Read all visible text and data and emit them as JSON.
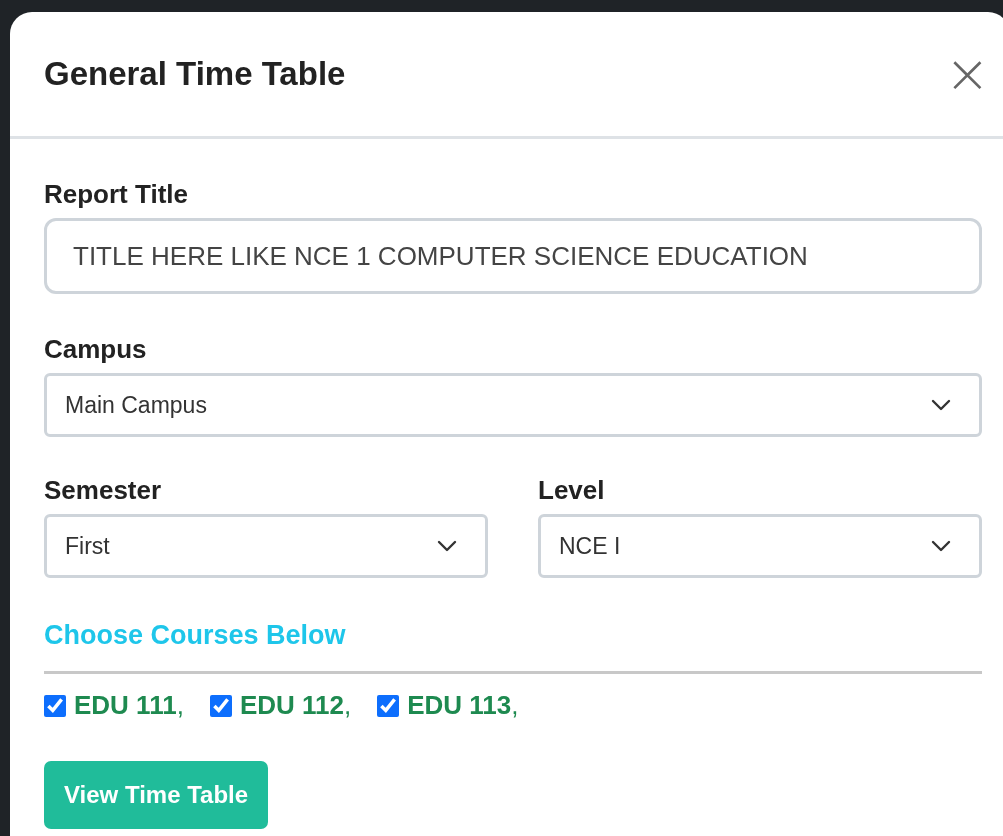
{
  "modal": {
    "title": "General Time Table",
    "close": "×"
  },
  "form": {
    "report_title": {
      "label": "Report Title",
      "placeholder": "TITLE HERE LIKE NCE 1 COMPUTER SCIENCE EDUCATION"
    },
    "campus": {
      "label": "Campus",
      "value": "Main Campus"
    },
    "semester": {
      "label": "Semester",
      "value": "First"
    },
    "level": {
      "label": "Level",
      "value": "NCE I"
    }
  },
  "courses": {
    "heading": "Choose Courses Below",
    "items": [
      {
        "label": "EDU 111",
        "separator": ",",
        "checked": true
      },
      {
        "label": "EDU 112",
        "separator": ",",
        "checked": true
      },
      {
        "label": "EDU 113",
        "separator": ",",
        "checked": true
      }
    ]
  },
  "button": "View Time Table"
}
